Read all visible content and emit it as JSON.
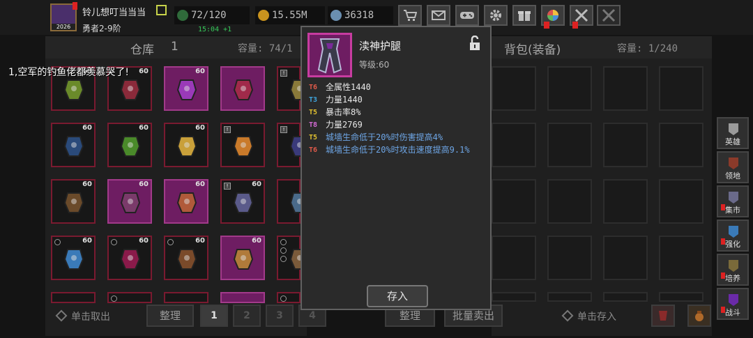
{
  "player": {
    "name": "铃儿想叮当当当",
    "rank": "勇者2-9阶",
    "avatar_level": "2026"
  },
  "resources": {
    "stamina": "72/120",
    "stamina_timer": "15:04 +1",
    "gold": "15.55M",
    "gems": "36318"
  },
  "topbar_buttons": [
    "shop-cart",
    "mail",
    "gamepad",
    "settings-gear",
    "gift",
    "lucky-wheel",
    "battle-alert",
    "swords-disabled"
  ],
  "warehouse": {
    "title": "仓库",
    "page": "1",
    "capacity": "容量: 74/1"
  },
  "backpack": {
    "title": "背包(装备)",
    "capacity": "容量: 1/240"
  },
  "chat_message": "1,空军的钓鱼佬都羡慕哭了!",
  "item_count": "60",
  "tooltip": {
    "name": "渎神护腿",
    "level": "等级:60",
    "attributes": [
      {
        "tier": "T6",
        "color": "#e05a4a",
        "text": "全属性1440",
        "special": false
      },
      {
        "tier": "T3",
        "color": "#3fa7e0",
        "text": "力量1440",
        "special": false
      },
      {
        "tier": "T5",
        "color": "#e0c030",
        "text": "暴击率8%",
        "special": false
      },
      {
        "tier": "T8",
        "color": "#d36ad4",
        "text": "力量2769",
        "special": false
      },
      {
        "tier": "T5",
        "color": "#e0c030",
        "text": "城墙生命低于20%时伤害提高4%",
        "special": true
      },
      {
        "tier": "T6",
        "color": "#e05a4a",
        "text": "城墙生命低于20%时攻击速度提高9.1%",
        "special": true
      }
    ],
    "deposit_label": "存入"
  },
  "bottom": {
    "single_take": "单击取出",
    "sort_left": "整理",
    "pages": [
      "1",
      "2",
      "3",
      "4"
    ],
    "sort_right": "整理",
    "bulk_sell": "批量卖出",
    "single_store": "单击存入"
  },
  "side_nav": [
    {
      "label": "英雄",
      "icon": "hero-helmet-icon"
    },
    {
      "label": "领地",
      "icon": "territory-castle-icon"
    },
    {
      "label": "集市",
      "icon": "market-stall-icon"
    },
    {
      "label": "强化",
      "icon": "enhance-crystal-icon"
    },
    {
      "label": "培养",
      "icon": "cultivate-altar-icon"
    },
    {
      "label": "战斗",
      "icon": "battle-portal-icon"
    }
  ],
  "colors": {
    "slot_border": "#7a1a30",
    "slot_purple": "#6e1d62",
    "special_attr": "#6ea6e6",
    "stamina_timer": "#36c95a"
  }
}
